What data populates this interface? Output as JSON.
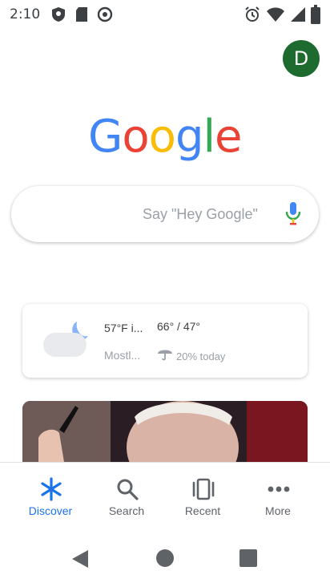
{
  "status_bar": {
    "time": "2:10",
    "left_icons": [
      "shield-icon",
      "sd-card-icon",
      "sync-icon"
    ],
    "right_icons": [
      "alarm-icon",
      "wifi-icon",
      "signal-icon",
      "battery-icon"
    ]
  },
  "account": {
    "avatar_letter": "D",
    "avatar_color": "#1e6b2f"
  },
  "logo": {
    "letters": [
      "G",
      "o",
      "o",
      "g",
      "l",
      "e"
    ],
    "colors": [
      "#4285f4",
      "#ea4335",
      "#fbbc05",
      "#4285f4",
      "#34a853",
      "#ea4335"
    ]
  },
  "search": {
    "placeholder": "Say \"Hey Google\"",
    "mic_icon": "mic-icon"
  },
  "weather": {
    "current_temp": "57°F i...",
    "condition": "Mostl...",
    "high_low": "66° / 47°",
    "rain_chance": "20% today",
    "icon": "partly-cloudy-night-icon"
  },
  "news_card": {
    "image": "news-photo"
  },
  "bottom_nav": {
    "items": [
      {
        "label": "Discover",
        "icon": "discover-icon",
        "active": true
      },
      {
        "label": "Search",
        "icon": "search-icon",
        "active": false
      },
      {
        "label": "Recent",
        "icon": "recent-icon",
        "active": false
      },
      {
        "label": "More",
        "icon": "more-icon",
        "active": false
      }
    ],
    "active_color": "#1a73e8"
  },
  "system_nav": [
    "back-icon",
    "home-icon",
    "overview-icon"
  ]
}
